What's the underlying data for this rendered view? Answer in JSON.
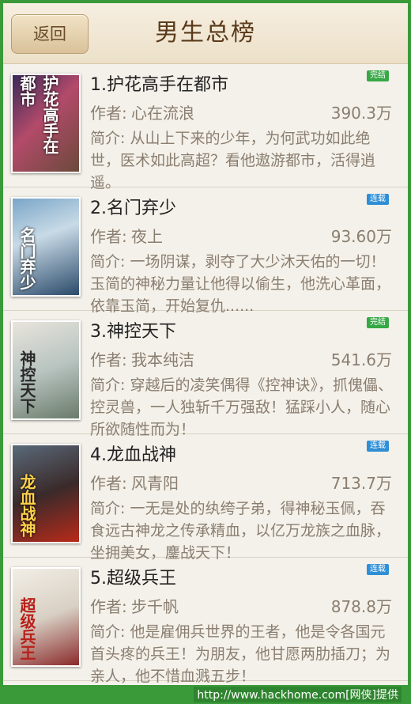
{
  "header": {
    "back_label": "返回",
    "title": "男生总榜"
  },
  "author_prefix": "作者:",
  "intro_prefix": "简介:",
  "colors": {
    "badge_done": "#36a845",
    "badge_serial": "#2f8fd6",
    "accent": "#8a7e70"
  },
  "items": [
    {
      "name": "1.护花高手在都市",
      "badge": "完结",
      "badge_type": "done",
      "author": "心在流浪",
      "count": "390.3万",
      "intro": "从山上下来的少年，为何武功如此绝世，医术如此高超？看他遨游都市，活得逍遥。",
      "cover_title": "护花高手在都市"
    },
    {
      "name": "2.名门弃少",
      "badge": "连载",
      "badge_type": "serial",
      "author": "夜上",
      "count": "93.60万",
      "intro": "一场阴谋，剥夺了大少沐天佑的一切！玉简的神秘力量让他得以偷生，他洗心革面，依靠玉简，开始复仇......",
      "cover_title": "名门弃少"
    },
    {
      "name": "3.神控天下",
      "badge": "完结",
      "badge_type": "done",
      "author": "我本纯洁",
      "count": "541.6万",
      "intro": "穿越后的凌笑偶得《控神诀》，抓傀儡、控灵兽，一人独斩千万强敌！猛踩小人，随心所欲随性而为！",
      "cover_title": "神控天下"
    },
    {
      "name": "4.龙血战神",
      "badge": "连载",
      "badge_type": "serial",
      "author": "风青阳",
      "count": "713.7万",
      "intro": "一无是处的纨绔子弟，得神秘玉佩，吞食远古神龙之传承精血，以亿万龙族之血脉，坐拥美女，鏖战天下！",
      "cover_title": "龙血战神"
    },
    {
      "name": "5.超级兵王",
      "badge": "连载",
      "badge_type": "serial",
      "author": "步千帆",
      "count": "878.8万",
      "intro": "他是雇佣兵世界的王者，他是令各国元首头疼的兵王！为朋友，他甘愿两肋插刀；为亲人，他不惜血溅五步！",
      "cover_title": "超级兵王"
    }
  ],
  "watermark": "http://www.hackhome.com[网侠]提供"
}
